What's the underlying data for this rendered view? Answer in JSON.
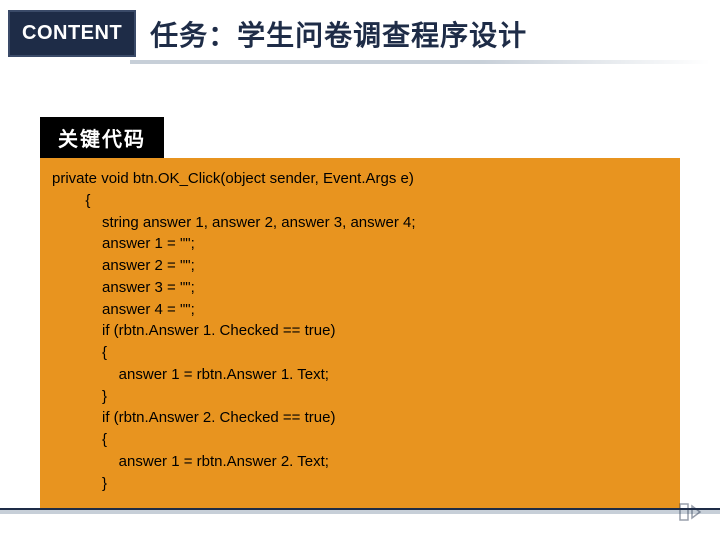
{
  "header": {
    "badge": "CONTENT",
    "title": "任务：学生问卷调查程序设计"
  },
  "code": {
    "label": "关键代码",
    "lines": [
      "private void btn.OK_Click(object sender, Event.Args e)",
      "        {",
      "            string answer 1, answer 2, answer 3, answer 4;",
      "            answer 1 = \"\";",
      "            answer 2 = \"\";",
      "            answer 3 = \"\";",
      "            answer 4 = \"\";",
      "            if (rbtn.Answer 1. Checked == true)",
      "            {",
      "                answer 1 = rbtn.Answer 1. Text;",
      "            }",
      "            if (rbtn.Answer 2. Checked == true)",
      "            {",
      "                answer 1 = rbtn.Answer 2. Text;",
      "            }"
    ]
  }
}
